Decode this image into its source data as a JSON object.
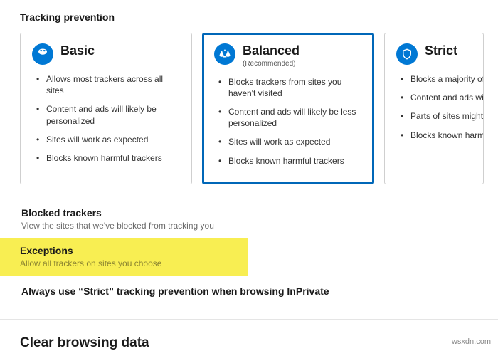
{
  "section_title": "Tracking prevention",
  "levels": {
    "basic": {
      "title": "Basic",
      "bullets": [
        "Allows most trackers across all sites",
        "Content and ads will likely be personalized",
        "Sites will work as expected",
        "Blocks known harmful trackers"
      ]
    },
    "balanced": {
      "title": "Balanced",
      "subtitle": "(Recommended)",
      "bullets": [
        "Blocks trackers from sites you haven't visited",
        "Content and ads will likely be less personalized",
        "Sites will work as expected",
        "Blocks known harmful trackers"
      ]
    },
    "strict": {
      "title": "Strict",
      "bullets": [
        "Blocks a majority of trackers from all sites",
        "Content and ads will likely have minimal personalization",
        "Parts of sites might not work",
        "Blocks known harmful trackers"
      ]
    }
  },
  "blocked": {
    "title": "Blocked trackers",
    "desc": "View the sites that we've blocked from tracking you"
  },
  "exceptions": {
    "title": "Exceptions",
    "desc": "Allow all trackers on sites you choose"
  },
  "inprivate": {
    "title": "Always use “Strict” tracking prevention when browsing InPrivate"
  },
  "clear_section": "Clear browsing data",
  "watermark": "wsxdn.com"
}
